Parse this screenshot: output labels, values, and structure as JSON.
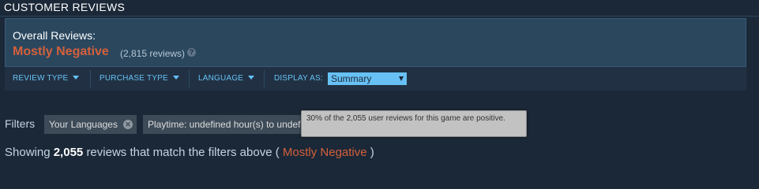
{
  "section_title": "CUSTOMER REVIEWS",
  "summary": {
    "label": "Overall Reviews:",
    "rating": "Mostly Negative",
    "count": "(2,815 reviews)",
    "help_icon": "question-mark-icon"
  },
  "filter_bar": {
    "review_type": "REVIEW TYPE",
    "purchase_type": "PURCHASE TYPE",
    "language": "LANGUAGE",
    "display_as_label": "DISPLAY AS:",
    "display_as_value": "Summary"
  },
  "active_filters": {
    "label": "Filters",
    "chips": [
      {
        "label": "Your Languages"
      },
      {
        "label": "Playtime: undefined hour(s) to undefined hour(s)"
      }
    ]
  },
  "tooltip": {
    "text": "30% of the 2,055 user reviews for this game are positive."
  },
  "showing": {
    "prefix": "Showing",
    "count": "2,055",
    "middle": "reviews that match the filters above (",
    "rating": "Mostly Negative",
    "suffix": ")"
  },
  "colors": {
    "background": "#1b2838",
    "panel": "#2a475e",
    "negative": "#d4603b",
    "link": "#67c1f5"
  }
}
